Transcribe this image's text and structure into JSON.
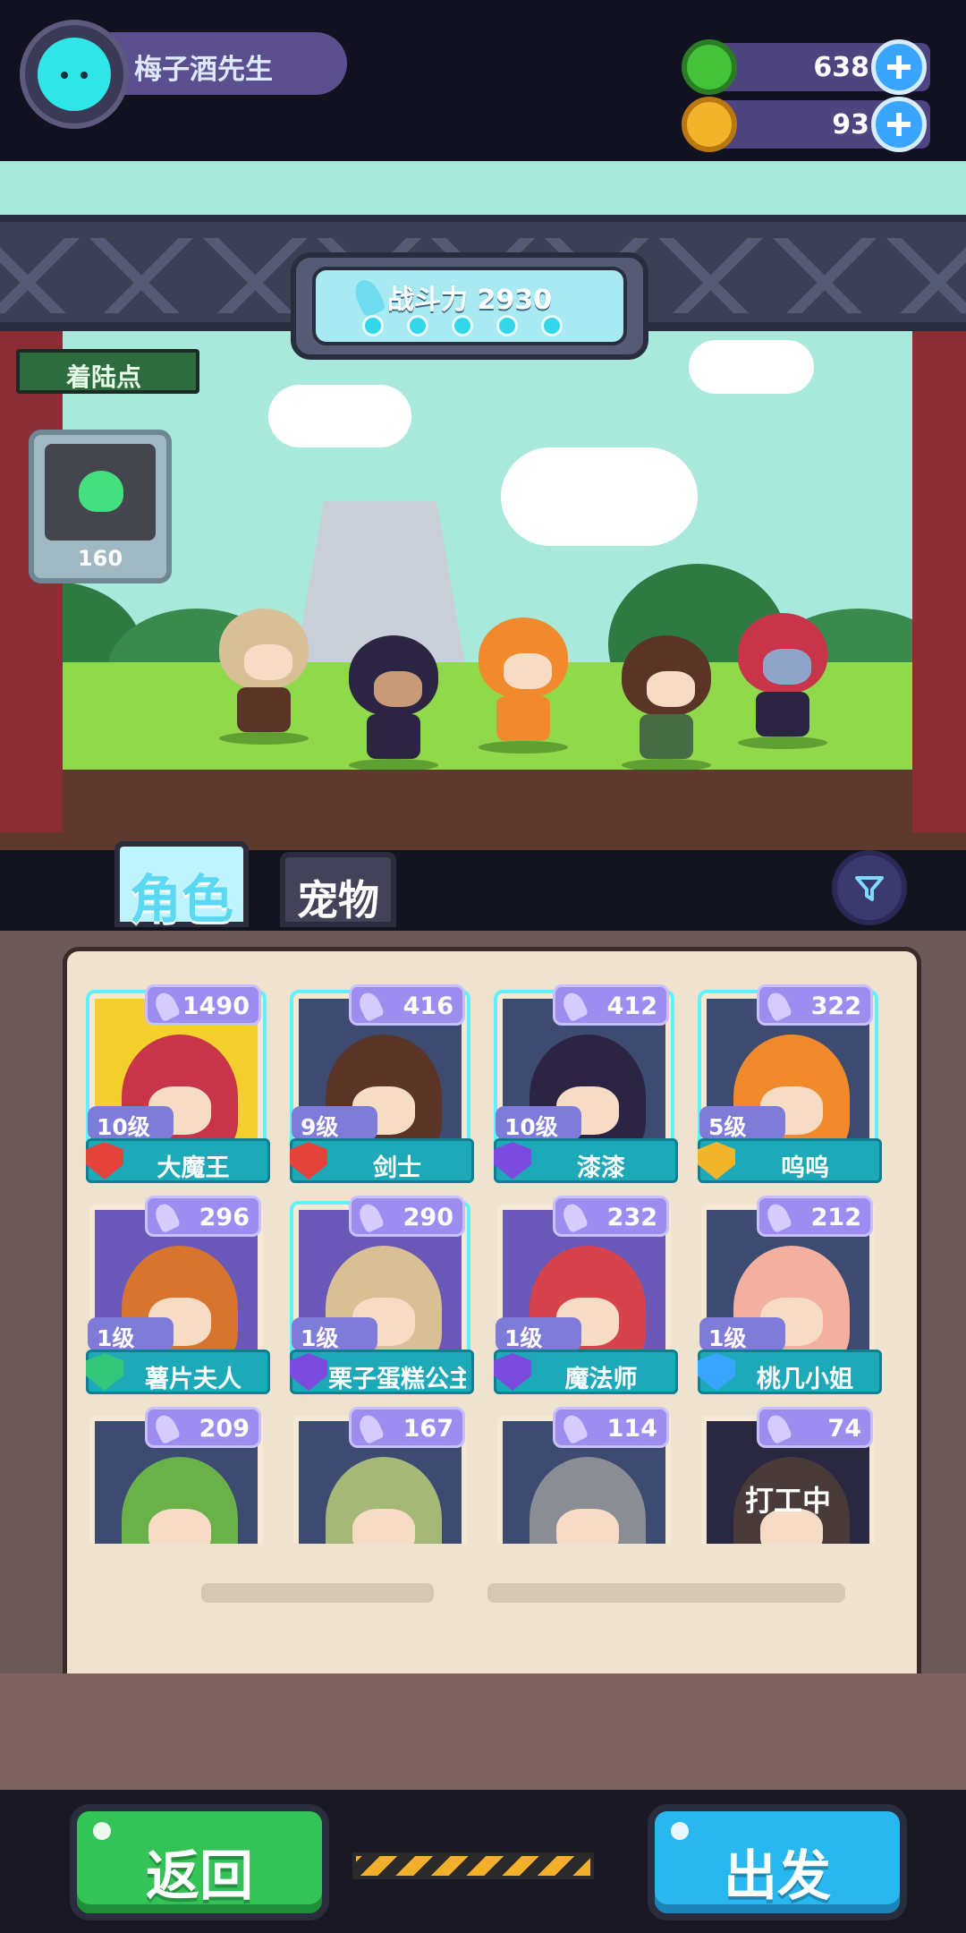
{
  "player": {
    "name": "梅子酒先生"
  },
  "currencies": [
    {
      "name": "gem-coin",
      "value": "638",
      "color": "#44c23a"
    },
    {
      "name": "planet-coin",
      "value": "93",
      "color": "#f2b42a"
    }
  ],
  "battle_power": {
    "label": "战斗力 2930"
  },
  "landing": {
    "title": "着陆点",
    "value": "160"
  },
  "tabs": {
    "characters": "角色",
    "pets": "宠物"
  },
  "cards": [
    {
      "power": "1490",
      "level": "10级",
      "name": "大魔王",
      "badge_color": "#e4433b",
      "bg": "#f5cf2e",
      "hair": "#c8344a",
      "selected": true
    },
    {
      "power": "416",
      "level": "9级",
      "name": "剑士",
      "badge_color": "#e4433b",
      "bg": "#3d4b70",
      "hair": "#5a3527",
      "selected": true
    },
    {
      "power": "412",
      "level": "10级",
      "name": "漆漆",
      "badge_color": "#7b4be0",
      "bg": "#3d4b70",
      "hair": "#2b2443",
      "selected": true
    },
    {
      "power": "322",
      "level": "5级",
      "name": "呜呜",
      "badge_color": "#f2b42a",
      "bg": "#3d4b70",
      "hair": "#f08a2c",
      "selected": true
    },
    {
      "power": "296",
      "level": "1级",
      "name": "薯片夫人",
      "badge_color": "#33c57a",
      "bg": "#6a58b8",
      "hair": "#d7742d",
      "selected": false
    },
    {
      "power": "290",
      "level": "1级",
      "name": "栗子蛋糕公主",
      "badge_color": "#7b4be0",
      "bg": "#6a58b8",
      "hair": "#d8bf95",
      "selected": true
    },
    {
      "power": "232",
      "level": "1级",
      "name": "魔法师",
      "badge_color": "#7b4be0",
      "bg": "#6a58b8",
      "hair": "#d6434d",
      "selected": false
    },
    {
      "power": "212",
      "level": "1级",
      "name": "桃几小姐",
      "badge_color": "#3aa5ff",
      "bg": "#3d4b70",
      "hair": "#f3b0a0",
      "selected": false
    },
    {
      "power": "209",
      "level": "",
      "name": "",
      "badge_color": "#33c57a",
      "bg": "#3d4b70",
      "hair": "#6bb14a",
      "selected": false
    },
    {
      "power": "167",
      "level": "",
      "name": "",
      "badge_color": "#7b4be0",
      "bg": "#3d4b70",
      "hair": "#a6b877",
      "selected": false
    },
    {
      "power": "114",
      "level": "",
      "name": "",
      "badge_color": "#7b4be0",
      "bg": "#3d4b70",
      "hair": "#8a8d93",
      "selected": false
    },
    {
      "power": "74",
      "level": "",
      "name": "",
      "busy": "打工中",
      "badge_color": "#3aa5ff",
      "bg": "#2a2740",
      "hair": "#4a3b3b",
      "selected": false
    }
  ],
  "buttons": {
    "back": "返回",
    "go": "出发"
  },
  "colors": {
    "accent_cyan": "#5ef2ff",
    "power_purple": "#9d8df0",
    "name_teal": "#1ea9b9"
  }
}
